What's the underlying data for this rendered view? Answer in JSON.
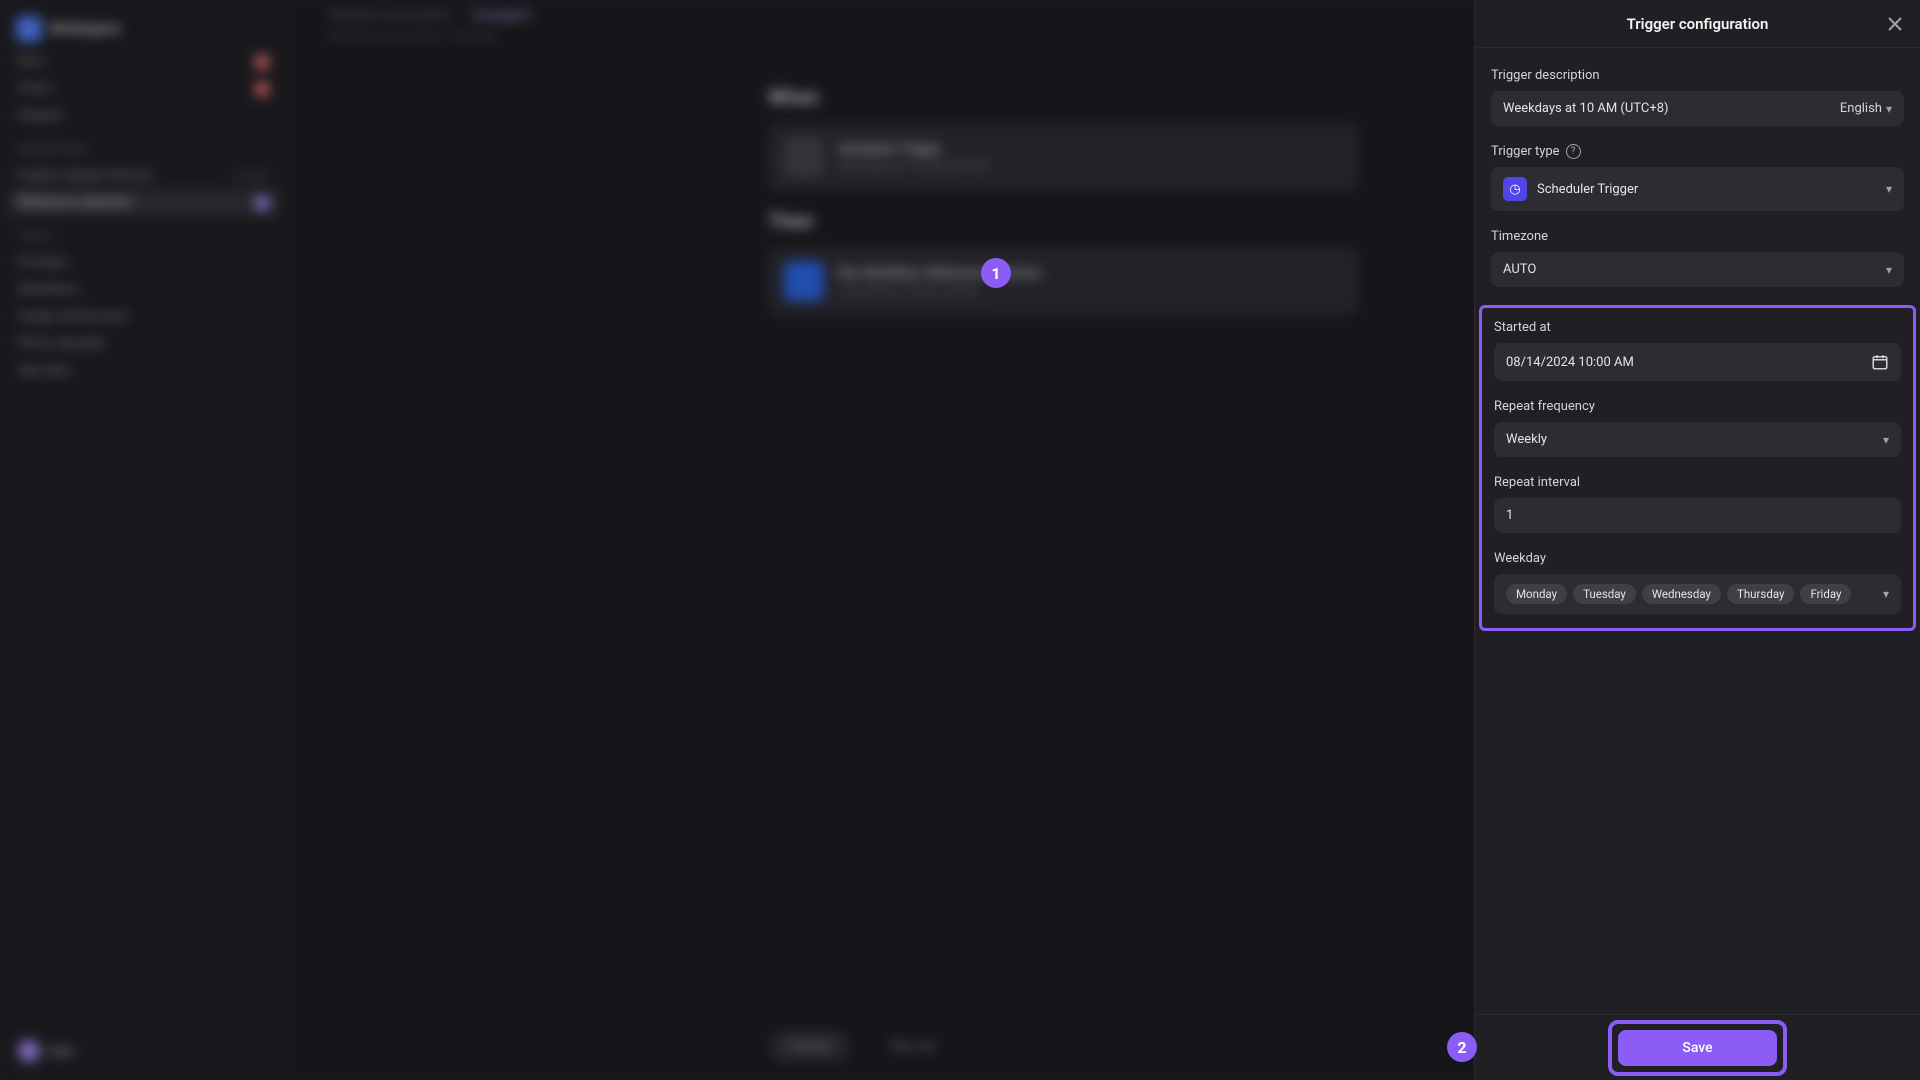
{
  "workspace_name": "Workspace",
  "sidebar": {
    "general": [
      {
        "label": "Bots",
        "dot": true
      },
      {
        "label": "Flows",
        "dot": true
      },
      {
        "label": "Dataset",
        "dot": false
      }
    ],
    "section_fav": "WORKFLOWS",
    "fav_items": [
      {
        "label": "English Update Delivery",
        "suffix": "3 hours"
      },
      {
        "label": "Reference selection",
        "dot": true
      }
    ],
    "section_tools": "TOOLS",
    "tools": [
      {
        "label": "Prompts"
      },
      {
        "label": "Workflows"
      },
      {
        "label": "Image upload upon"
      },
      {
        "label": "Photo uploader"
      },
      {
        "label": "App data"
      }
    ],
    "user": "User"
  },
  "top_tabs": {
    "workflows": "Workflow automation",
    "useragent": "Useragent"
  },
  "breadcrumb": "Workflow automation · Updated",
  "flow": {
    "when_label": "When",
    "then_label": "Then",
    "when_card": {
      "title": "Scheduler Trigger",
      "sub": "Weekdays at 10 AM (UTC+8)"
    },
    "then_card": {
      "title": "Run Workflow: Reference selection",
      "sub": "Last edited: Today, 9:30am"
    }
  },
  "bottom_bar": {
    "publish": "Publish",
    "testrun": "Test run"
  },
  "panel": {
    "title": "Trigger configuration",
    "desc_label": "Trigger description",
    "desc_value": "Weekdays at 10 AM (UTC+8)",
    "lang": "English",
    "type_label": "Trigger type",
    "type_value": "Scheduler Trigger",
    "tz_label": "Timezone",
    "tz_value": "AUTO",
    "started_label": "Started at",
    "started_value": "08/14/2024 10:00 AM",
    "repeat_freq_label": "Repeat frequency",
    "repeat_freq_value": "Weekly",
    "repeat_int_label": "Repeat interval",
    "repeat_int_value": "1",
    "weekday_label": "Weekday",
    "weekdays": [
      "Monday",
      "Tuesday",
      "Wednesday",
      "Thursday",
      "Friday"
    ],
    "save": "Save"
  },
  "callouts": {
    "one": "1",
    "two": "2"
  }
}
